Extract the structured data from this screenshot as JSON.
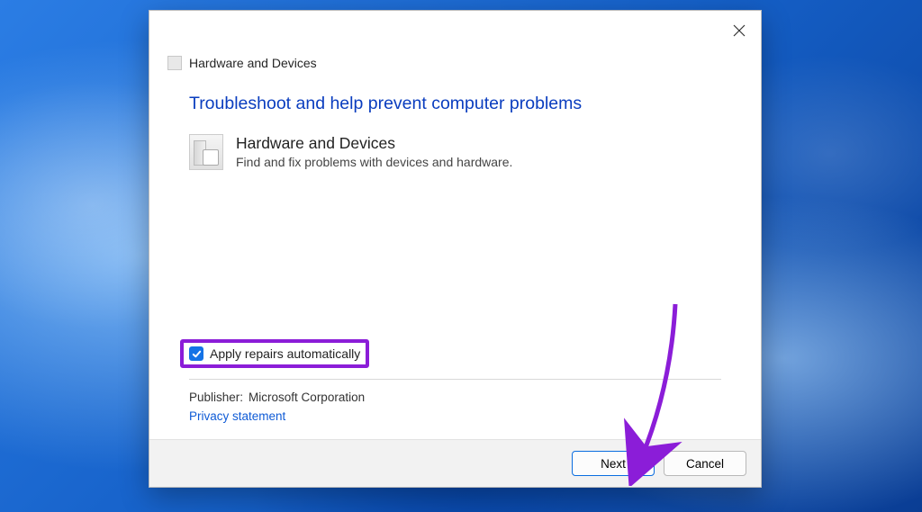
{
  "dialog": {
    "title": "Hardware and Devices",
    "heading": "Troubleshoot and help prevent computer problems",
    "troubleshooter": {
      "name": "Hardware and Devices",
      "description": "Find and fix problems with devices and hardware."
    },
    "checkbox": {
      "label": "Apply repairs automatically",
      "checked": true
    },
    "publisher": {
      "label": "Publisher:",
      "value": "Microsoft Corporation"
    },
    "privacy_link": "Privacy statement",
    "buttons": {
      "next": "Next",
      "cancel": "Cancel"
    }
  }
}
